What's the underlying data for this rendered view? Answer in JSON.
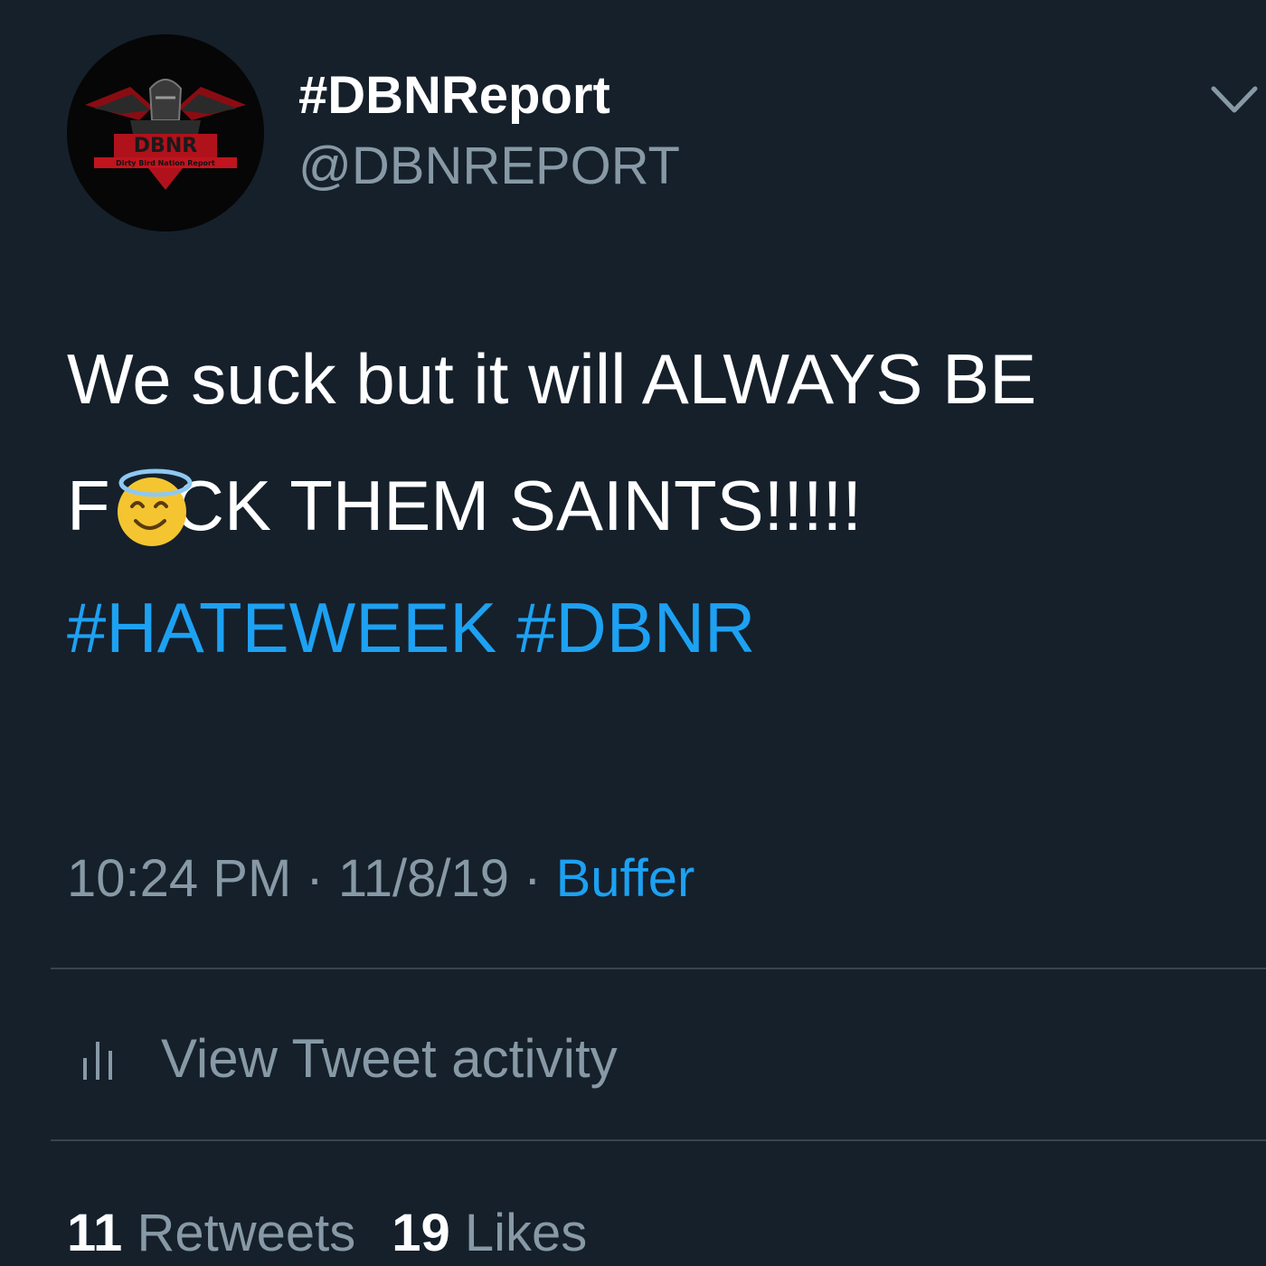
{
  "author": {
    "display_name": "#DBNReport",
    "handle": "@DBNREPORT",
    "avatar_text": "DBNR",
    "avatar_subtext": "Dirty Bird Nation Report"
  },
  "tweet": {
    "line1": "We suck but it will ALWAYS BE",
    "line2_prefix": "F",
    "line2_suffix": "CK THEM SAINTS!!!!!",
    "emoji": "smiling-face-with-halo",
    "hashtag1": "#HATEWEEK",
    "hashtag2": "#DBNR"
  },
  "meta": {
    "time": "10:24 PM",
    "separator": " · ",
    "date": "11/8/19",
    "source": "Buffer"
  },
  "activity": {
    "label": "View Tweet activity"
  },
  "stats": {
    "retweets_count": "11",
    "retweets_label": "Retweets",
    "likes_count": "19",
    "likes_label": "Likes"
  },
  "colors": {
    "background": "#15202b",
    "link": "#1da1f2",
    "secondary_text": "#8899a6",
    "divider": "#38444d"
  }
}
